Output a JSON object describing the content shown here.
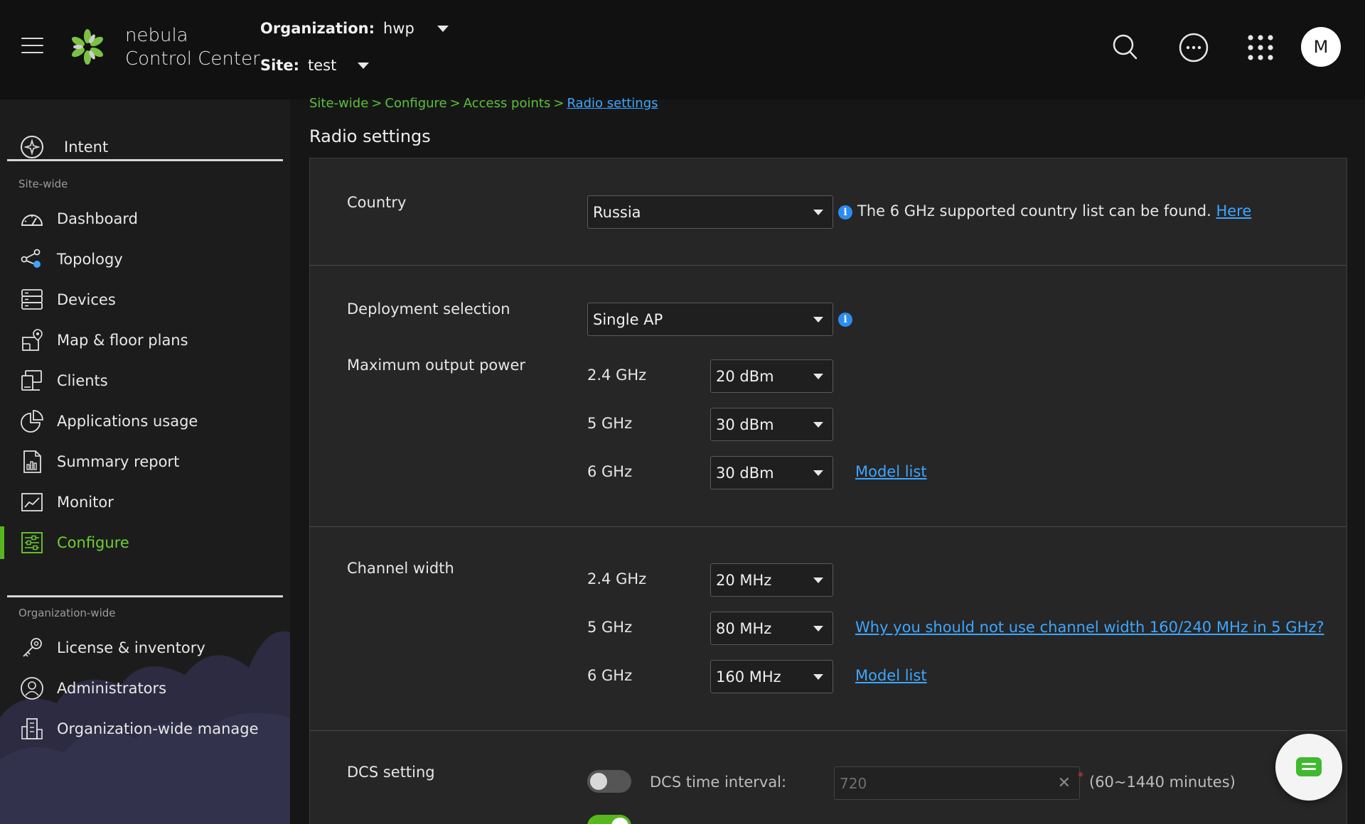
{
  "header": {
    "brand_line1": "nebula",
    "brand_line2": "Control Center",
    "org_label": "Organization:",
    "org_value": "hwp",
    "site_label": "Site:",
    "site_value": "test",
    "avatar_initial": "M"
  },
  "sidebar": {
    "intent_label": "Intent",
    "site_wide_label": "Site-wide",
    "site_items": [
      {
        "label": "Dashboard",
        "icon": "dashboard-icon"
      },
      {
        "label": "Topology",
        "icon": "topology-icon"
      },
      {
        "label": "Devices",
        "icon": "devices-icon"
      },
      {
        "label": "Map & floor plans",
        "icon": "map-icon"
      },
      {
        "label": "Clients",
        "icon": "clients-icon"
      },
      {
        "label": "Applications usage",
        "icon": "pie-chart-icon"
      },
      {
        "label": "Summary report",
        "icon": "report-icon"
      },
      {
        "label": "Monitor",
        "icon": "monitor-icon"
      },
      {
        "label": "Configure",
        "icon": "configure-icon",
        "active": true
      }
    ],
    "org_wide_label": "Organization-wide",
    "org_items": [
      {
        "label": "License & inventory",
        "icon": "key-icon"
      },
      {
        "label": "Administrators",
        "icon": "administrators-icon"
      },
      {
        "label": "Organization-wide manage",
        "icon": "building-icon"
      }
    ]
  },
  "breadcrumb": {
    "items": [
      "Site-wide",
      "Configure",
      "Access points"
    ],
    "separator": ">",
    "current": "Radio settings"
  },
  "page_title": "Radio settings",
  "country": {
    "label": "Country",
    "value": "Russia",
    "hint": "The 6 GHz supported country list can be found.",
    "link": "Here"
  },
  "deployment": {
    "label": "Deployment selection",
    "value": "Single AP"
  },
  "output_power": {
    "label": "Maximum output power",
    "rows": [
      {
        "band": "2.4 GHz",
        "value": "20 dBm"
      },
      {
        "band": "5 GHz",
        "value": "30 dBm"
      },
      {
        "band": "6 GHz",
        "value": "30 dBm",
        "link": "Model list"
      }
    ]
  },
  "channel_width": {
    "label": "Channel width",
    "rows": [
      {
        "band": "2.4 GHz",
        "value": "20 MHz"
      },
      {
        "band": "5 GHz",
        "value": "80 MHz",
        "link": "Why you should not use channel width 160/240 MHz in 5 GHz?"
      },
      {
        "band": "6 GHz",
        "value": "160 MHz",
        "link": "Model list"
      }
    ]
  },
  "dcs": {
    "label": "DCS setting",
    "enabled": false,
    "interval_label": "DCS time interval:",
    "interval_value": "720",
    "range_hint": "(60~1440 minutes)",
    "second_toggle_on": true
  },
  "colors": {
    "accent_green": "#58b71f",
    "link_blue": "#3ea6ff",
    "background": "#161616",
    "panel": "#262626"
  }
}
